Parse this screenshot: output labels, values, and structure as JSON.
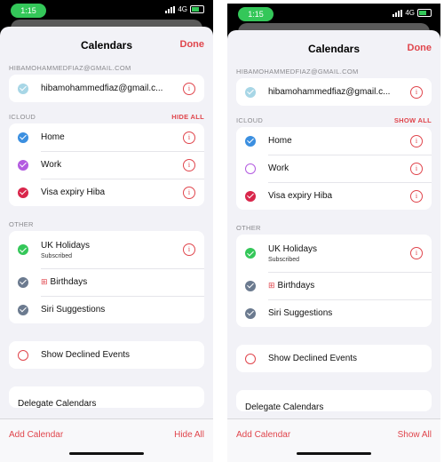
{
  "colors": {
    "accent": "#e0454c",
    "home": "#3b8fe0",
    "work": "#b35be0",
    "visa": "#d9264b",
    "ukholidays": "#34c759",
    "muted": "#6b7a8f",
    "account": "#a7d6e6"
  },
  "status": {
    "time": "1:15",
    "network": "4G"
  },
  "screens": [
    {
      "title": "Calendars",
      "done": "Done",
      "account_label": "HIBAMOHAMMEDFIAZ@GMAIL.COM",
      "account_row": "hibamohammedfiaz@gmail.c...",
      "icloud_label": "ICLOUD",
      "icloud_action": "HIDE ALL",
      "home": "Home",
      "work": "Work",
      "visa": "Visa expiry Hiba",
      "other_label": "OTHER",
      "uk_holidays": "UK Holidays",
      "uk_sub": "Subscribed",
      "birthdays": "Birthdays",
      "siri": "Siri Suggestions",
      "declined": "Show Declined Events",
      "delegate": "Delegate Calendars",
      "add_calendar": "Add Calendar",
      "toggle_all": "Hide All",
      "work_checked": true
    },
    {
      "title": "Calendars",
      "done": "Done",
      "account_label": "HIBAMOHAMMEDFIAZ@GMAIL.COM",
      "account_row": "hibamohammedfiaz@gmail.c...",
      "icloud_label": "ICLOUD",
      "icloud_action": "SHOW ALL",
      "home": "Home",
      "work": "Work",
      "visa": "Visa expiry Hiba",
      "other_label": "OTHER",
      "uk_holidays": "UK Holidays",
      "uk_sub": "Subscribed",
      "birthdays": "Birthdays",
      "siri": "Siri Suggestions",
      "declined": "Show Declined Events",
      "delegate": "Delegate Calendars",
      "add_calendar": "Add Calendar",
      "toggle_all": "Show All",
      "work_checked": false
    }
  ]
}
